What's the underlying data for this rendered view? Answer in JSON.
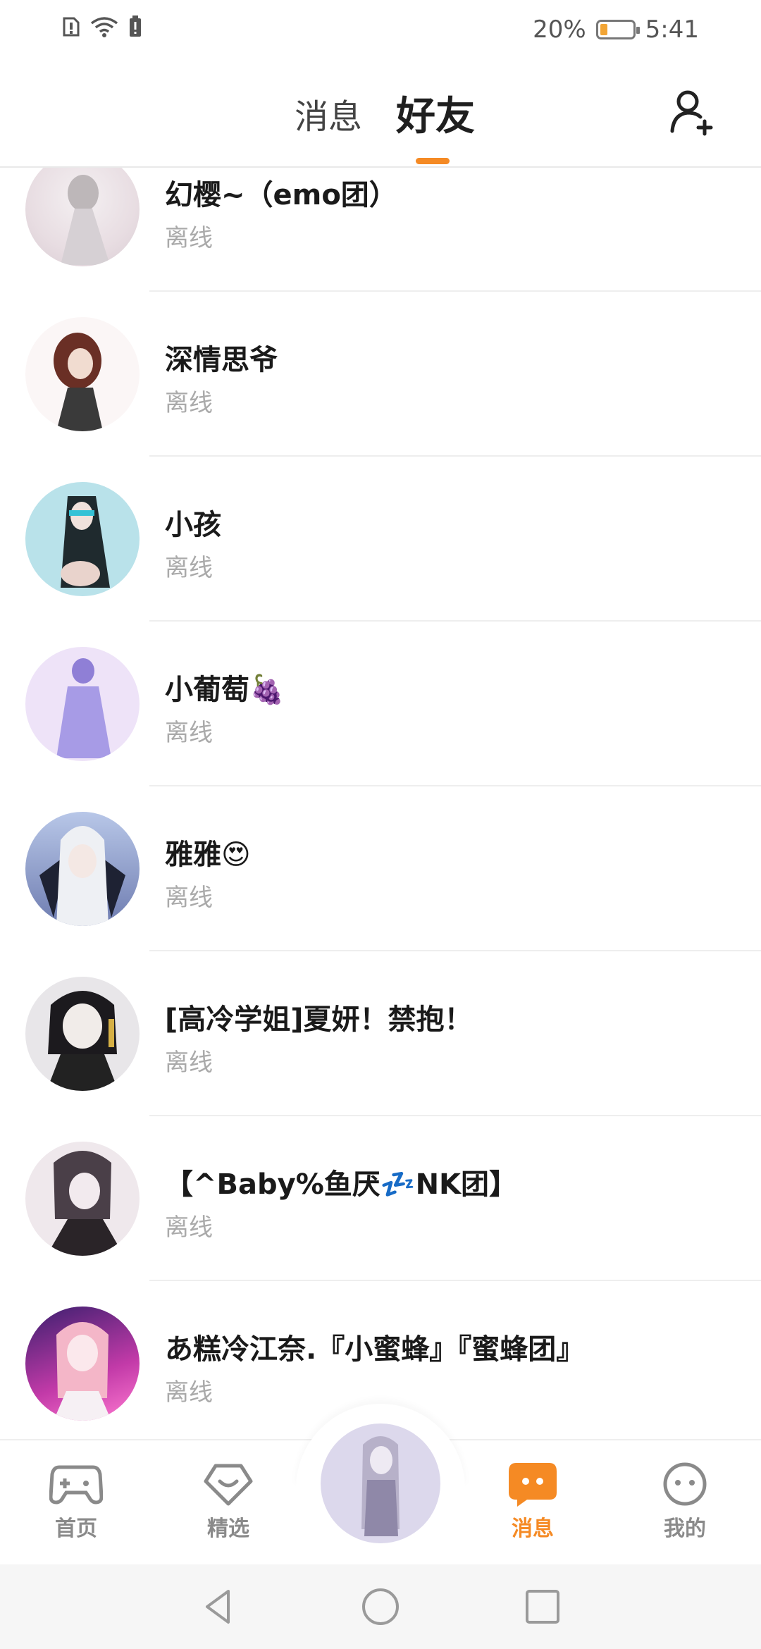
{
  "status_bar": {
    "left_icons": [
      "alert-icon",
      "wifi-icon",
      "battery-alert-icon"
    ],
    "battery_percent": "20%",
    "time": "5:41"
  },
  "header": {
    "tab_messages": "消息",
    "tab_friends": "好友",
    "active_tab": "好友",
    "add_friend_icon": "add-person-icon"
  },
  "friends": [
    {
      "name": "幻樱~（emo团）",
      "status": "离线"
    },
    {
      "name": "深情思爷",
      "status": "离线"
    },
    {
      "name": "小孩",
      "status": "离线"
    },
    {
      "name": "小葡萄🍇",
      "status": "离线"
    },
    {
      "name": "雅雅😍",
      "status": "离线"
    },
    {
      "name": "[高冷学姐]夏妍！禁抱！",
      "status": "离线"
    },
    {
      "name": "【^Baby%鱼厌💤NK团】",
      "status": "离线"
    },
    {
      "name": "あ糕冷江奈.『小蜜蜂』『蜜蜂团』",
      "status": "离线"
    }
  ],
  "bottom_nav": {
    "home": "首页",
    "featured": "精选",
    "messages": "消息",
    "profile": "我的",
    "active": "消息"
  },
  "colors": {
    "accent": "#f58a24",
    "status_gray": "#aaaaaa"
  }
}
